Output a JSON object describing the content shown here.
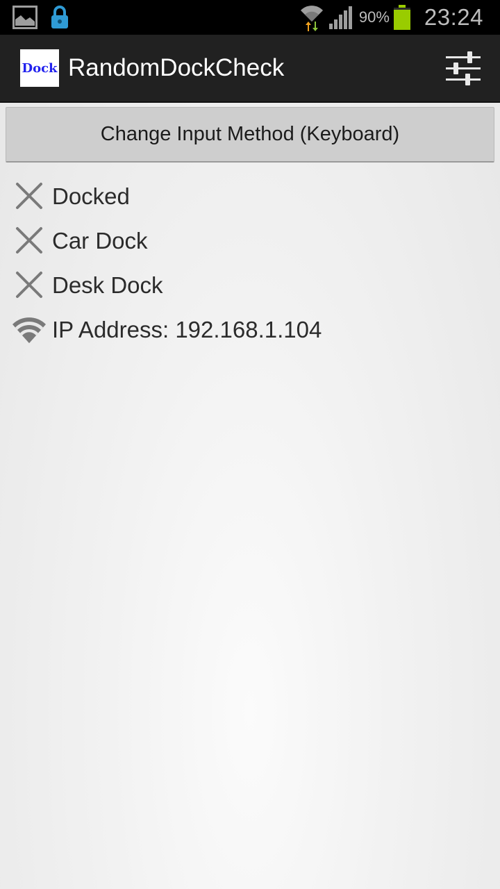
{
  "status_bar": {
    "battery": "90%",
    "time": "23:24",
    "icons": [
      "gallery-icon",
      "lock-icon",
      "wifi-data-icon",
      "signal-icon",
      "battery-icon"
    ],
    "battery_color": "#99cc00"
  },
  "action_bar": {
    "app_icon_text": "Dock",
    "title": "RandomDockCheck",
    "settings_icon": "sliders-icon"
  },
  "main": {
    "keyboard_button_label": "Change Input Method (Keyboard)",
    "items": [
      {
        "icon": "cross-icon",
        "label": "Docked"
      },
      {
        "icon": "cross-icon",
        "label": "Car Dock"
      },
      {
        "icon": "cross-icon",
        "label": "Desk Dock"
      },
      {
        "icon": "wifi-icon",
        "label": "IP Address: 192.168.1.104"
      }
    ]
  }
}
